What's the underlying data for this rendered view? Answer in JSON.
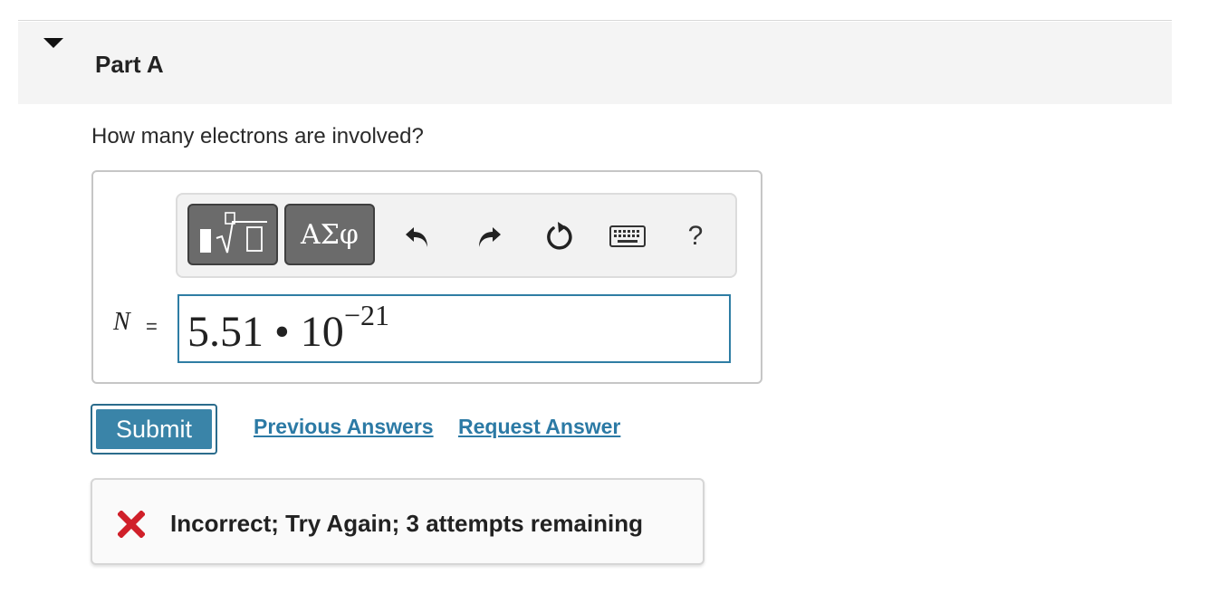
{
  "part": {
    "title": "Part A",
    "expanded": true
  },
  "question": {
    "text": "How many electrons are involved?"
  },
  "toolbar": {
    "templates_icon": "fraction-radical-template-icon",
    "symbols_label": "ΑΣφ",
    "undo_icon": "undo-icon",
    "redo_icon": "redo-icon",
    "reset_icon": "reset-icon",
    "keyboard_icon": "keyboard-icon",
    "help_label": "?"
  },
  "answer": {
    "variable": "N",
    "equals": "=",
    "mantissa_expr": "5.51 • 10",
    "exponent": "−21"
  },
  "actions": {
    "submit_label": "Submit",
    "previous_answers_label": "Previous Answers",
    "request_answer_label": "Request Answer"
  },
  "feedback": {
    "icon": "red-x-icon",
    "text": "Incorrect; Try Again; 3 attempts remaining"
  },
  "colors": {
    "accent": "#2c7aa5",
    "submit_bg": "#3a84a8",
    "error_red": "#d0202a",
    "input_border": "#2e7da4"
  }
}
